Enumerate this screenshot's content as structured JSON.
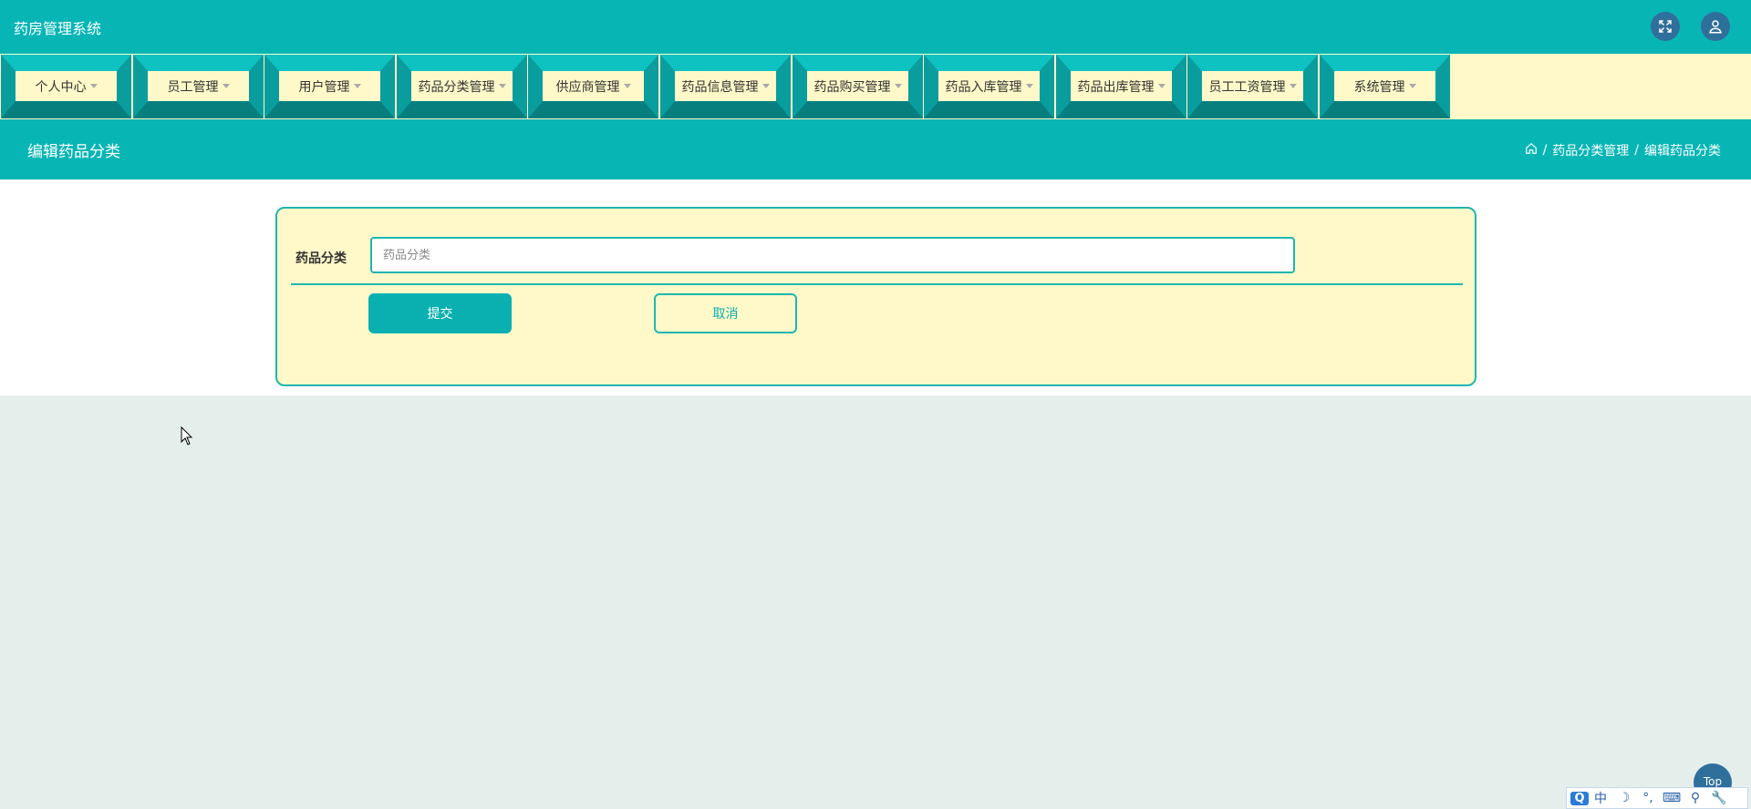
{
  "app": {
    "title": "药房管理系统"
  },
  "header_icons": {
    "fullscreen": "expand-icon",
    "user": "user-icon"
  },
  "nav": {
    "items": [
      {
        "label": "个人中心"
      },
      {
        "label": "员工管理"
      },
      {
        "label": "用户管理"
      },
      {
        "label": "药品分类管理"
      },
      {
        "label": "供应商管理"
      },
      {
        "label": "药品信息管理"
      },
      {
        "label": "药品购买管理"
      },
      {
        "label": "药品入库管理"
      },
      {
        "label": "药品出库管理"
      },
      {
        "label": "员工工资管理"
      },
      {
        "label": "系统管理"
      }
    ]
  },
  "page": {
    "title": "编辑药品分类",
    "breadcrumb": [
      "/",
      "药品分类管理",
      "/",
      "编辑药品分类"
    ]
  },
  "form": {
    "field_label": "药品分类",
    "field_placeholder": "药品分类",
    "field_value": "",
    "submit_label": "提交",
    "cancel_label": "取消"
  },
  "back_to_top": {
    "label": "Top"
  },
  "ime": {
    "items": [
      "中",
      "☽",
      "°,",
      "⌨",
      "⚲",
      "🔧"
    ]
  },
  "colors": {
    "primary": "#08b5b5",
    "nav_background": "#fff9c9",
    "dark_accent": "#2f6f9c"
  }
}
